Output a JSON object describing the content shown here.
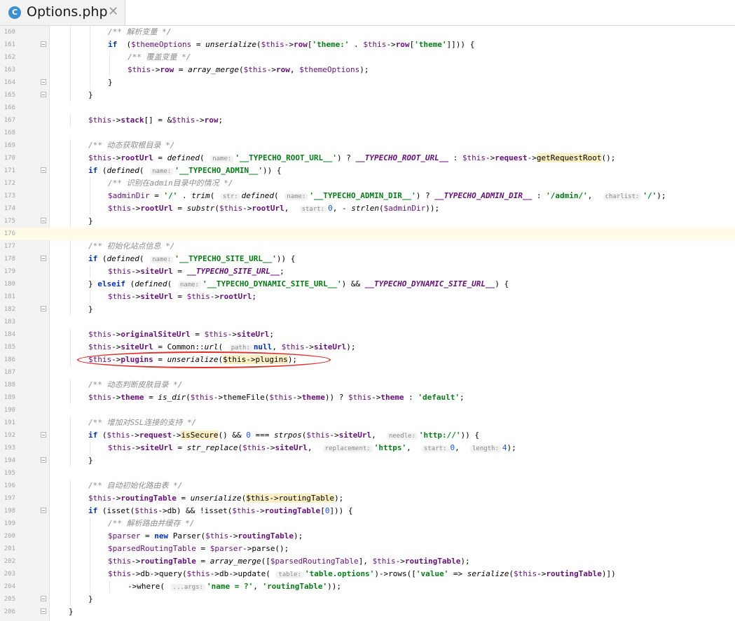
{
  "tab": {
    "icon": "php-class-icon",
    "icon_letter": "C",
    "title": "Options.php",
    "close": "✕"
  },
  "annotation_color": "#e0302a",
  "lines": [
    {
      "n": "160",
      "indent": 2,
      "segs": [
        [
          "cm",
          "/** 解析变量 */"
        ]
      ]
    },
    {
      "n": "161",
      "indent": 2,
      "segs": [
        [
          "kw",
          "if"
        ],
        [
          "",
          "  ("
        ],
        [
          "vr",
          "$themeOptions"
        ],
        [
          "",
          " = "
        ],
        [
          "fn",
          "unserialize"
        ],
        [
          "",
          "("
        ],
        [
          "vr",
          "$this"
        ],
        [
          "",
          "->"
        ],
        [
          "pr",
          "row"
        ],
        [
          "",
          "["
        ],
        [
          "st",
          "'theme:'"
        ],
        [
          "",
          " . "
        ],
        [
          "vr",
          "$this"
        ],
        [
          "",
          "->"
        ],
        [
          "pr",
          "row"
        ],
        [
          "",
          "["
        ],
        [
          "st",
          "'theme'"
        ],
        [
          "",
          "]])) {"
        ]
      ]
    },
    {
      "n": "162",
      "indent": 3,
      "segs": [
        [
          "cm",
          "/** 覆盖变量 */"
        ]
      ]
    },
    {
      "n": "163",
      "indent": 3,
      "segs": [
        [
          "vr",
          "$this"
        ],
        [
          "",
          "->"
        ],
        [
          "pr",
          "row"
        ],
        [
          "",
          " = "
        ],
        [
          "fn",
          "array_merge"
        ],
        [
          "",
          "("
        ],
        [
          "vr",
          "$this"
        ],
        [
          "",
          "->"
        ],
        [
          "pr",
          "row"
        ],
        [
          "",
          ", "
        ],
        [
          "vr",
          "$themeOptions"
        ],
        [
          "",
          ");"
        ]
      ]
    },
    {
      "n": "164",
      "indent": 2,
      "segs": [
        [
          "",
          "}"
        ]
      ]
    },
    {
      "n": "165",
      "indent": 1,
      "segs": [
        [
          "",
          "}"
        ]
      ]
    },
    {
      "n": "166",
      "indent": 0,
      "segs": []
    },
    {
      "n": "167",
      "indent": 1,
      "segs": [
        [
          "vr",
          "$this"
        ],
        [
          "",
          "->"
        ],
        [
          "pr",
          "stack"
        ],
        [
          "",
          "[] = &"
        ],
        [
          "vr",
          "$this"
        ],
        [
          "",
          "->"
        ],
        [
          "pr",
          "row"
        ],
        [
          "",
          ";"
        ]
      ]
    },
    {
      "n": "168",
      "indent": 0,
      "segs": []
    },
    {
      "n": "169",
      "indent": 1,
      "segs": [
        [
          "cm",
          "/** 动态获取根目录 */"
        ]
      ]
    },
    {
      "n": "170",
      "indent": 1,
      "segs": [
        [
          "vr",
          "$this"
        ],
        [
          "",
          "->"
        ],
        [
          "pr",
          "rootUrl"
        ],
        [
          "",
          " = "
        ],
        [
          "fn",
          "defined"
        ],
        [
          "",
          "( "
        ],
        [
          "hint",
          "name:"
        ],
        [
          "st",
          "'__TYPECHO_ROOT_URL__'"
        ],
        [
          "",
          ") ? "
        ],
        [
          "cn",
          "__TYPECHO_ROOT_URL__"
        ],
        [
          "",
          " : "
        ],
        [
          "vr",
          "$this"
        ],
        [
          "",
          "->"
        ],
        [
          "pr",
          "request"
        ],
        [
          "",
          "->"
        ],
        [
          "hl",
          "getRequestRoot"
        ],
        [
          "",
          "();"
        ]
      ]
    },
    {
      "n": "171",
      "indent": 1,
      "segs": [
        [
          "kw",
          "if"
        ],
        [
          "",
          " ("
        ],
        [
          "fn",
          "defined"
        ],
        [
          "",
          "( "
        ],
        [
          "hint",
          "name:"
        ],
        [
          "st",
          "'__TYPECHO_ADMIN__'"
        ],
        [
          "",
          ")) {"
        ]
      ]
    },
    {
      "n": "172",
      "indent": 2,
      "segs": [
        [
          "cm",
          "/** 识别在admin目录中的情况 */"
        ]
      ]
    },
    {
      "n": "173",
      "indent": 2,
      "segs": [
        [
          "vr",
          "$adminDir"
        ],
        [
          "",
          " = "
        ],
        [
          "st",
          "'/'"
        ],
        [
          "",
          " . "
        ],
        [
          "fn",
          "trim"
        ],
        [
          "",
          "( "
        ],
        [
          "hint",
          "str:"
        ],
        [
          "fn",
          "defined"
        ],
        [
          "",
          "( "
        ],
        [
          "hint",
          "name:"
        ],
        [
          "st",
          "'__TYPECHO_ADMIN_DIR__'"
        ],
        [
          "",
          ") ? "
        ],
        [
          "cn",
          "__TYPECHO_ADMIN_DIR__"
        ],
        [
          "",
          " : "
        ],
        [
          "st",
          "'/admin/'"
        ],
        [
          "",
          ",  "
        ],
        [
          "hint",
          "charlist:"
        ],
        [
          "st",
          "'/'"
        ],
        [
          "",
          ");"
        ]
      ]
    },
    {
      "n": "174",
      "indent": 2,
      "segs": [
        [
          "vr",
          "$this"
        ],
        [
          "",
          "->"
        ],
        [
          "pr",
          "rootUrl"
        ],
        [
          "",
          " = "
        ],
        [
          "fn",
          "substr"
        ],
        [
          "",
          "("
        ],
        [
          "vr",
          "$this"
        ],
        [
          "",
          "->"
        ],
        [
          "pr",
          "rootUrl"
        ],
        [
          "",
          ",  "
        ],
        [
          "hint",
          "start:"
        ],
        [
          "nm",
          "0"
        ],
        [
          "",
          ", - "
        ],
        [
          "fn",
          "strlen"
        ],
        [
          "",
          "("
        ],
        [
          "vr",
          "$adminDir"
        ],
        [
          "",
          "));"
        ]
      ]
    },
    {
      "n": "175",
      "indent": 1,
      "segs": [
        [
          "",
          "}"
        ]
      ]
    },
    {
      "n": "176",
      "indent": 0,
      "segs": [],
      "current": true
    },
    {
      "n": "177",
      "indent": 1,
      "segs": [
        [
          "cm",
          "/** 初始化站点信息 */"
        ]
      ]
    },
    {
      "n": "178",
      "indent": 1,
      "segs": [
        [
          "kw",
          "if"
        ],
        [
          "",
          " ("
        ],
        [
          "fn",
          "defined"
        ],
        [
          "",
          "( "
        ],
        [
          "hint",
          "name:"
        ],
        [
          "st",
          "'__TYPECHO_SITE_URL__'"
        ],
        [
          "",
          ")) {"
        ]
      ]
    },
    {
      "n": "179",
      "indent": 2,
      "segs": [
        [
          "vr",
          "$this"
        ],
        [
          "",
          "->"
        ],
        [
          "pr",
          "siteUrl"
        ],
        [
          "",
          " = "
        ],
        [
          "cn",
          "__TYPECHO_SITE_URL__"
        ],
        [
          "",
          ";"
        ]
      ]
    },
    {
      "n": "180",
      "indent": 1,
      "segs": [
        [
          "",
          "} "
        ],
        [
          "kw",
          "elseif"
        ],
        [
          "",
          " ("
        ],
        [
          "fn",
          "defined"
        ],
        [
          "",
          "( "
        ],
        [
          "hint",
          "name:"
        ],
        [
          "st",
          "'__TYPECHO_DYNAMIC_SITE_URL__'"
        ],
        [
          "",
          ") && "
        ],
        [
          "cn",
          "__TYPECHO_DYNAMIC_SITE_URL__"
        ],
        [
          "",
          ") {"
        ]
      ]
    },
    {
      "n": "181",
      "indent": 2,
      "segs": [
        [
          "vr",
          "$this"
        ],
        [
          "",
          "->"
        ],
        [
          "pr",
          "siteUrl"
        ],
        [
          "",
          " = "
        ],
        [
          "vr",
          "$this"
        ],
        [
          "",
          "->"
        ],
        [
          "pr",
          "rootUrl"
        ],
        [
          "",
          ";"
        ]
      ]
    },
    {
      "n": "182",
      "indent": 1,
      "segs": [
        [
          "",
          "}"
        ]
      ]
    },
    {
      "n": "183",
      "indent": 0,
      "segs": []
    },
    {
      "n": "184",
      "indent": 1,
      "segs": [
        [
          "vr",
          "$this"
        ],
        [
          "",
          "->"
        ],
        [
          "pr",
          "originalSiteUrl"
        ],
        [
          "",
          " = "
        ],
        [
          "vr",
          "$this"
        ],
        [
          "",
          "->"
        ],
        [
          "pr",
          "siteUrl"
        ],
        [
          "",
          ";"
        ]
      ]
    },
    {
      "n": "185",
      "indent": 1,
      "segs": [
        [
          "vr",
          "$this"
        ],
        [
          "",
          "->"
        ],
        [
          "pr",
          "siteUrl"
        ],
        [
          "",
          " = Common::"
        ],
        [
          "fn",
          "url"
        ],
        [
          "",
          "( "
        ],
        [
          "hint",
          "path:"
        ],
        [
          "kw",
          "null"
        ],
        [
          "",
          ", "
        ],
        [
          "vr",
          "$this"
        ],
        [
          "",
          "->"
        ],
        [
          "pr",
          "siteUrl"
        ],
        [
          "",
          ");"
        ]
      ]
    },
    {
      "n": "186",
      "indent": 1,
      "segs": [
        [
          "vr",
          "$this"
        ],
        [
          "",
          "->"
        ],
        [
          "pr",
          "plugins"
        ],
        [
          "",
          " = "
        ],
        [
          "fn",
          "unserialize"
        ],
        [
          "",
          "("
        ],
        [
          "hl",
          "$this->plugins"
        ],
        [
          "",
          ");"
        ]
      ]
    },
    {
      "n": "187",
      "indent": 0,
      "segs": []
    },
    {
      "n": "188",
      "indent": 1,
      "segs": [
        [
          "cm",
          "/** 动态判断皮肤目录 */"
        ]
      ]
    },
    {
      "n": "189",
      "indent": 1,
      "segs": [
        [
          "vr",
          "$this"
        ],
        [
          "",
          "->"
        ],
        [
          "pr",
          "theme"
        ],
        [
          "",
          " = "
        ],
        [
          "fn",
          "is_dir"
        ],
        [
          "",
          "("
        ],
        [
          "vr",
          "$this"
        ],
        [
          "",
          "->themeFile("
        ],
        [
          "vr",
          "$this"
        ],
        [
          "",
          "->"
        ],
        [
          "pr",
          "theme"
        ],
        [
          "",
          ")) ? "
        ],
        [
          "vr",
          "$this"
        ],
        [
          "",
          "->"
        ],
        [
          "pr",
          "theme"
        ],
        [
          "",
          " : "
        ],
        [
          "st",
          "'default'"
        ],
        [
          "",
          ";"
        ]
      ]
    },
    {
      "n": "190",
      "indent": 0,
      "segs": []
    },
    {
      "n": "191",
      "indent": 1,
      "segs": [
        [
          "cm",
          "/** 增加对SSL连接的支持 */"
        ]
      ]
    },
    {
      "n": "192",
      "indent": 1,
      "segs": [
        [
          "kw",
          "if"
        ],
        [
          "",
          " ("
        ],
        [
          "vr",
          "$this"
        ],
        [
          "",
          "->"
        ],
        [
          "pr",
          "request"
        ],
        [
          "",
          "->"
        ],
        [
          "hl",
          "isSecure"
        ],
        [
          "",
          "() && "
        ],
        [
          "nm",
          "0"
        ],
        [
          "",
          " === "
        ],
        [
          "fn",
          "strpos"
        ],
        [
          "",
          "("
        ],
        [
          "vr",
          "$this"
        ],
        [
          "",
          "->"
        ],
        [
          "pr",
          "siteUrl"
        ],
        [
          "",
          ",  "
        ],
        [
          "hint",
          "needle:"
        ],
        [
          "st",
          "'http://'"
        ],
        [
          "",
          ")) {"
        ]
      ]
    },
    {
      "n": "193",
      "indent": 2,
      "segs": [
        [
          "vr",
          "$this"
        ],
        [
          "",
          "->"
        ],
        [
          "pr",
          "siteUrl"
        ],
        [
          "",
          " = "
        ],
        [
          "fn",
          "str_replace"
        ],
        [
          "",
          "("
        ],
        [
          "vr",
          "$this"
        ],
        [
          "",
          "->"
        ],
        [
          "pr",
          "siteUrl"
        ],
        [
          "",
          ",  "
        ],
        [
          "hint",
          "replacement:"
        ],
        [
          "st",
          "'https'"
        ],
        [
          "",
          ",  "
        ],
        [
          "hint",
          "start:"
        ],
        [
          "nm",
          "0"
        ],
        [
          "",
          ",  "
        ],
        [
          "hint",
          "length:"
        ],
        [
          "nm",
          "4"
        ],
        [
          "",
          ");"
        ]
      ]
    },
    {
      "n": "194",
      "indent": 1,
      "segs": [
        [
          "",
          "}"
        ]
      ]
    },
    {
      "n": "195",
      "indent": 0,
      "segs": []
    },
    {
      "n": "196",
      "indent": 1,
      "segs": [
        [
          "cm",
          "/** 自动初始化路由表 */"
        ]
      ]
    },
    {
      "n": "197",
      "indent": 1,
      "segs": [
        [
          "vr",
          "$this"
        ],
        [
          "",
          "->"
        ],
        [
          "pr",
          "routingTable"
        ],
        [
          "",
          " = "
        ],
        [
          "fn",
          "unserialize"
        ],
        [
          "",
          "("
        ],
        [
          "hl",
          "$this->routingTable"
        ],
        [
          "",
          ");"
        ]
      ]
    },
    {
      "n": "198",
      "indent": 1,
      "segs": [
        [
          "kw",
          "if"
        ],
        [
          "",
          " (isset("
        ],
        [
          "vr",
          "$this"
        ],
        [
          "",
          "->db) && !isset("
        ],
        [
          "vr",
          "$this"
        ],
        [
          "",
          "->"
        ],
        [
          "pr",
          "routingTable"
        ],
        [
          "",
          "["
        ],
        [
          "nm",
          "0"
        ],
        [
          "",
          "])) {"
        ]
      ]
    },
    {
      "n": "199",
      "indent": 2,
      "segs": [
        [
          "cm",
          "/** 解析路由并缓存 */"
        ]
      ]
    },
    {
      "n": "200",
      "indent": 2,
      "segs": [
        [
          "vr",
          "$parser"
        ],
        [
          "",
          " = "
        ],
        [
          "kw",
          "new"
        ],
        [
          "",
          " Parser("
        ],
        [
          "vr",
          "$this"
        ],
        [
          "",
          "->"
        ],
        [
          "pr",
          "routingTable"
        ],
        [
          "",
          ");"
        ]
      ]
    },
    {
      "n": "201",
      "indent": 2,
      "segs": [
        [
          "vr",
          "$parsedRoutingTable"
        ],
        [
          "",
          " = "
        ],
        [
          "vr",
          "$parser"
        ],
        [
          "",
          "->parse();"
        ]
      ]
    },
    {
      "n": "202",
      "indent": 2,
      "segs": [
        [
          "vr",
          "$this"
        ],
        [
          "",
          "->"
        ],
        [
          "pr",
          "routingTable"
        ],
        [
          "",
          " = "
        ],
        [
          "fn",
          "array_merge"
        ],
        [
          "",
          "(["
        ],
        [
          "vr",
          "$parsedRoutingTable"
        ],
        [
          "",
          "], "
        ],
        [
          "vr",
          "$this"
        ],
        [
          "",
          "->"
        ],
        [
          "pr",
          "routingTable"
        ],
        [
          "",
          ");"
        ]
      ]
    },
    {
      "n": "203",
      "indent": 2,
      "segs": [
        [
          "vr",
          "$this"
        ],
        [
          "",
          "->db->query("
        ],
        [
          "vr",
          "$this"
        ],
        [
          "",
          "->db->update( "
        ],
        [
          "hint",
          "table:"
        ],
        [
          "st",
          "'table.options'"
        ],
        [
          "",
          ")->rows(["
        ],
        [
          "st",
          "'value'"
        ],
        [
          "",
          " => "
        ],
        [
          "fn",
          "serialize"
        ],
        [
          "",
          "("
        ],
        [
          "vr",
          "$this"
        ],
        [
          "",
          "->"
        ],
        [
          "pr",
          "routingTable"
        ],
        [
          "",
          ")])"
        ]
      ]
    },
    {
      "n": "204",
      "indent": 3,
      "segs": [
        [
          "",
          "->where( "
        ],
        [
          "hint",
          "...args:"
        ],
        [
          "st",
          "'name = ?'"
        ],
        [
          "",
          ", "
        ],
        [
          "st",
          "'routingTable'"
        ],
        [
          "",
          "));"
        ]
      ]
    },
    {
      "n": "205",
      "indent": 1,
      "segs": [
        [
          "",
          "}"
        ]
      ]
    },
    {
      "n": "206",
      "indent": 0,
      "segs": [
        [
          "",
          "}"
        ]
      ]
    }
  ]
}
